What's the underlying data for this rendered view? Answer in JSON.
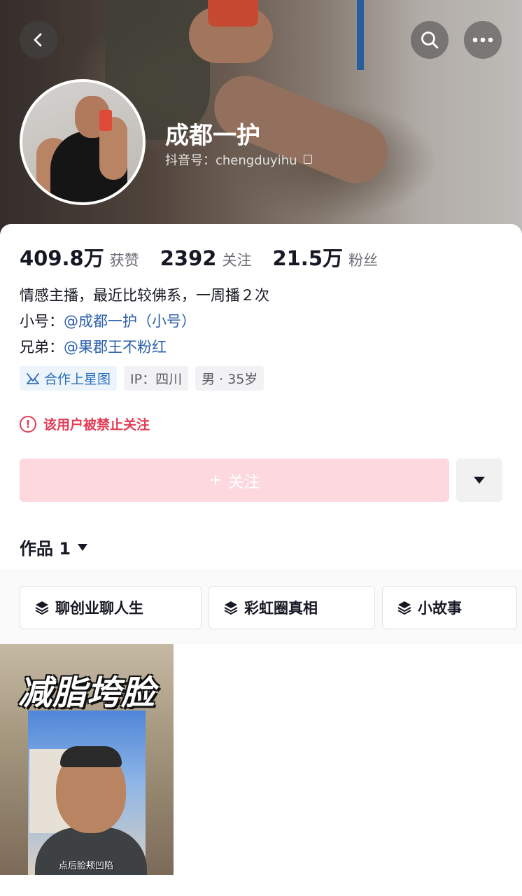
{
  "profile": {
    "name": "成都一护",
    "douyin_id": "抖音号：chengduyihu"
  },
  "stats": [
    {
      "value": "409.8万",
      "label": "获赞"
    },
    {
      "value": "2392",
      "label": "关注"
    },
    {
      "value": "21.5万",
      "label": "粉丝"
    }
  ],
  "bio": {
    "line1": "情感主播，最近比较佛系，一周播２次",
    "line2_label": "小号：",
    "line2_link": "@成都一护（小号）",
    "line3_label": "兄弟：",
    "line3_link": "@果郡王不粉红"
  },
  "tags": {
    "star": "合作上星图",
    "ip": "IP：四川",
    "gender_age": "男 · 35岁"
  },
  "warning": {
    "icon": "!",
    "text": "该用户被禁止关注"
  },
  "actions": {
    "follow_plus": "+",
    "follow_label": "关注"
  },
  "works": {
    "label": "作品 1"
  },
  "collections": [
    {
      "label": "聊创业聊人生"
    },
    {
      "label": "彩虹圈真相"
    },
    {
      "label": "小故事"
    }
  ],
  "video": {
    "title": "减脂垮脸",
    "caption": "点后脸颊凹陷"
  },
  "colors": {
    "accent_pink": "#fdd8df",
    "warning_red": "#e23d55",
    "link_blue": "#2b5fab"
  }
}
